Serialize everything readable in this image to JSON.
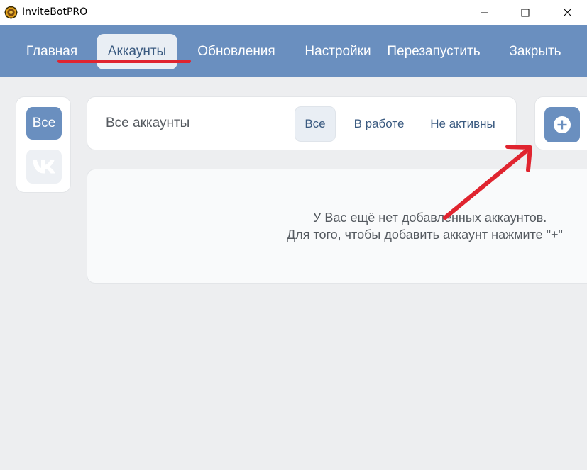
{
  "window": {
    "title": "InviteBotPRO",
    "icon": "gear-icon",
    "controls": [
      "minimize-icon",
      "maximize-icon",
      "close-icon"
    ]
  },
  "nav": {
    "items": [
      {
        "label": "Главная"
      },
      {
        "label": "Аккаунты",
        "active": true
      },
      {
        "label": "Обновления"
      },
      {
        "label": "Настройки"
      },
      {
        "label": "Перезапустить"
      },
      {
        "label": "Закрыть"
      }
    ]
  },
  "sidebar": {
    "all_label": "Все",
    "vk_icon": "vk-logo-icon"
  },
  "accounts": {
    "title": "Все аккаунты",
    "tabs": [
      {
        "label": "Все",
        "active": true
      },
      {
        "label": "В работе"
      },
      {
        "label": "Не активны"
      }
    ],
    "add_icon": "plus-circle-icon"
  },
  "empty_state": {
    "line1": "У Вас ещё нет добавленных аккаунтов.",
    "line2": "Для того, чтобы добавить аккаунт нажмите \"+\""
  },
  "colors": {
    "accent": "#6a8fbf",
    "annotation": "#e0242f",
    "background": "#edeef0"
  }
}
